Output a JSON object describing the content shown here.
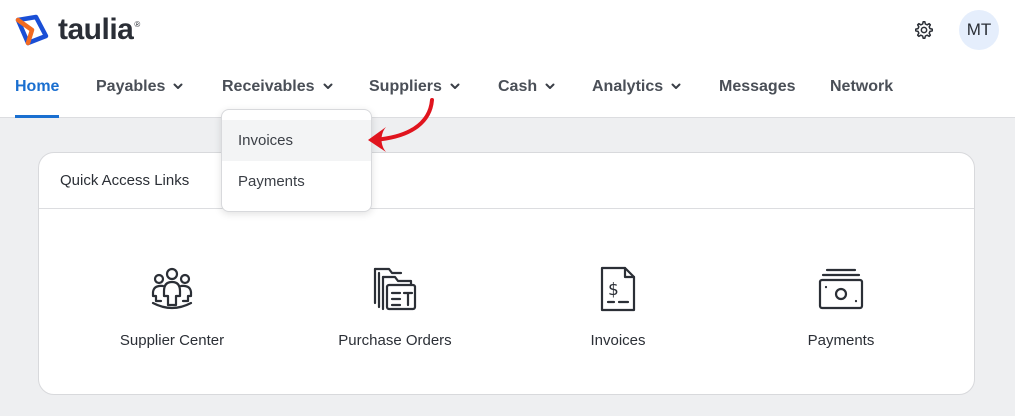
{
  "brand": {
    "name": "taulia",
    "trademark": "®",
    "logo_colors": [
      "#f26a21",
      "#1a4fd6"
    ]
  },
  "header": {
    "settings_icon": "gear-icon",
    "avatar_initials": "MT"
  },
  "nav": {
    "accent_color": "#1a6fd0",
    "items": [
      {
        "label": "Home",
        "active": true,
        "has_menu": false
      },
      {
        "label": "Payables",
        "has_menu": true
      },
      {
        "label": "Receivables",
        "has_menu": true
      },
      {
        "label": "Suppliers",
        "has_menu": true
      },
      {
        "label": "Cash",
        "has_menu": true
      },
      {
        "label": "Analytics",
        "has_menu": true
      },
      {
        "label": "Messages",
        "has_menu": false
      },
      {
        "label": "Network",
        "has_menu": false
      }
    ]
  },
  "receivables_menu": {
    "items": [
      {
        "label": "Invoices",
        "highlighted": true
      },
      {
        "label": "Payments",
        "highlighted": false
      }
    ]
  },
  "annotation": {
    "arrow_color": "#e0141e",
    "points_to": "Invoices"
  },
  "quick_access": {
    "title": "Quick Access Links",
    "links": [
      {
        "label": "Supplier Center",
        "icon": "people-group-icon"
      },
      {
        "label": "Purchase Orders",
        "icon": "purchase-orders-icon"
      },
      {
        "label": "Invoices",
        "icon": "invoice-document-icon"
      },
      {
        "label": "Payments",
        "icon": "cash-payment-icon"
      }
    ]
  }
}
